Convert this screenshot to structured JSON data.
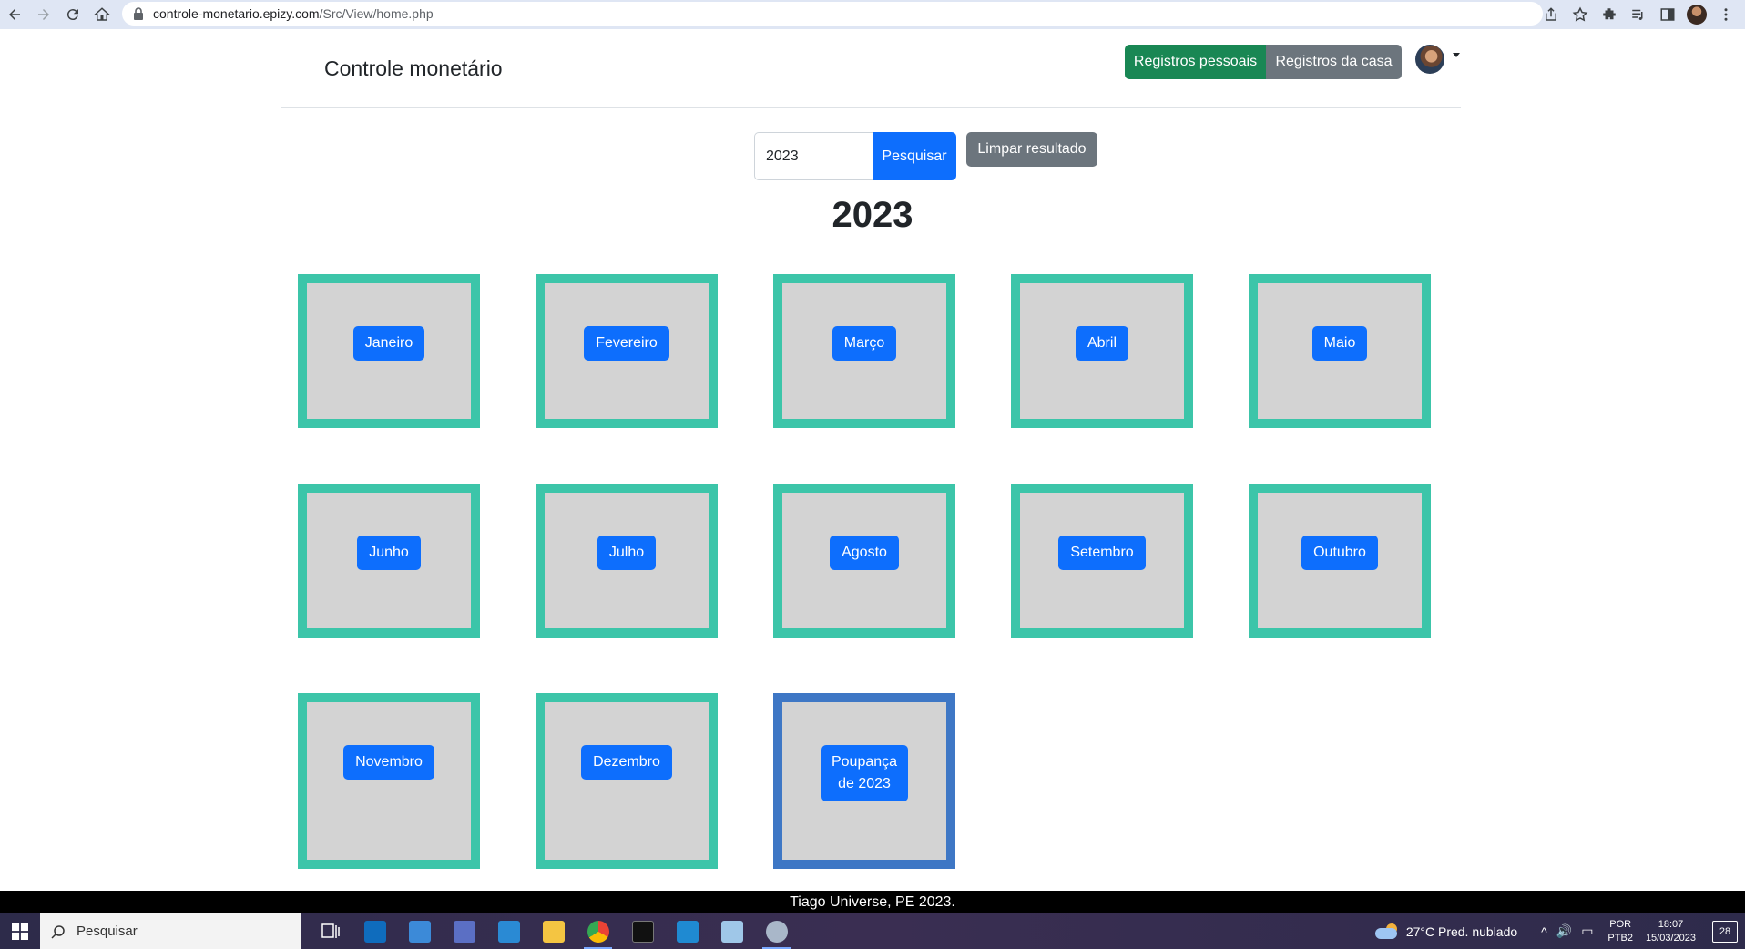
{
  "browser": {
    "url_host": "controle-monetario.epizy.com",
    "url_path": "/Src/View/home.php"
  },
  "header": {
    "brand": "Controle monetário",
    "personal_label": "Registros pessoais",
    "house_label": "Registros da casa"
  },
  "search": {
    "value": "2023",
    "button_label": "Pesquisar",
    "clear_label": "Limpar resultado"
  },
  "year_title": "2023",
  "months": [
    {
      "label": "Janeiro"
    },
    {
      "label": "Fevereiro"
    },
    {
      "label": "Março"
    },
    {
      "label": "Abril"
    },
    {
      "label": "Maio"
    },
    {
      "label": "Junho"
    },
    {
      "label": "Julho"
    },
    {
      "label": "Agosto"
    },
    {
      "label": "Setembro"
    },
    {
      "label": "Outubro"
    },
    {
      "label": "Novembro"
    },
    {
      "label": "Dezembro"
    }
  ],
  "savings": {
    "label": "Poupança de 2023"
  },
  "footer": "Tiago Universe, PE 2023.",
  "taskbar": {
    "search_placeholder": "Pesquisar",
    "weather": "27°C  Pred. nublado",
    "lang_top": "POR",
    "lang_bottom": "PTB2",
    "time": "18:07",
    "date": "15/03/2023",
    "notifications": "28"
  },
  "colors": {
    "tile_border": "#3cc5a9",
    "savings_border": "#3e77c5",
    "primary": "#0d6efd",
    "success": "#198754",
    "secondary": "#6c757d"
  }
}
